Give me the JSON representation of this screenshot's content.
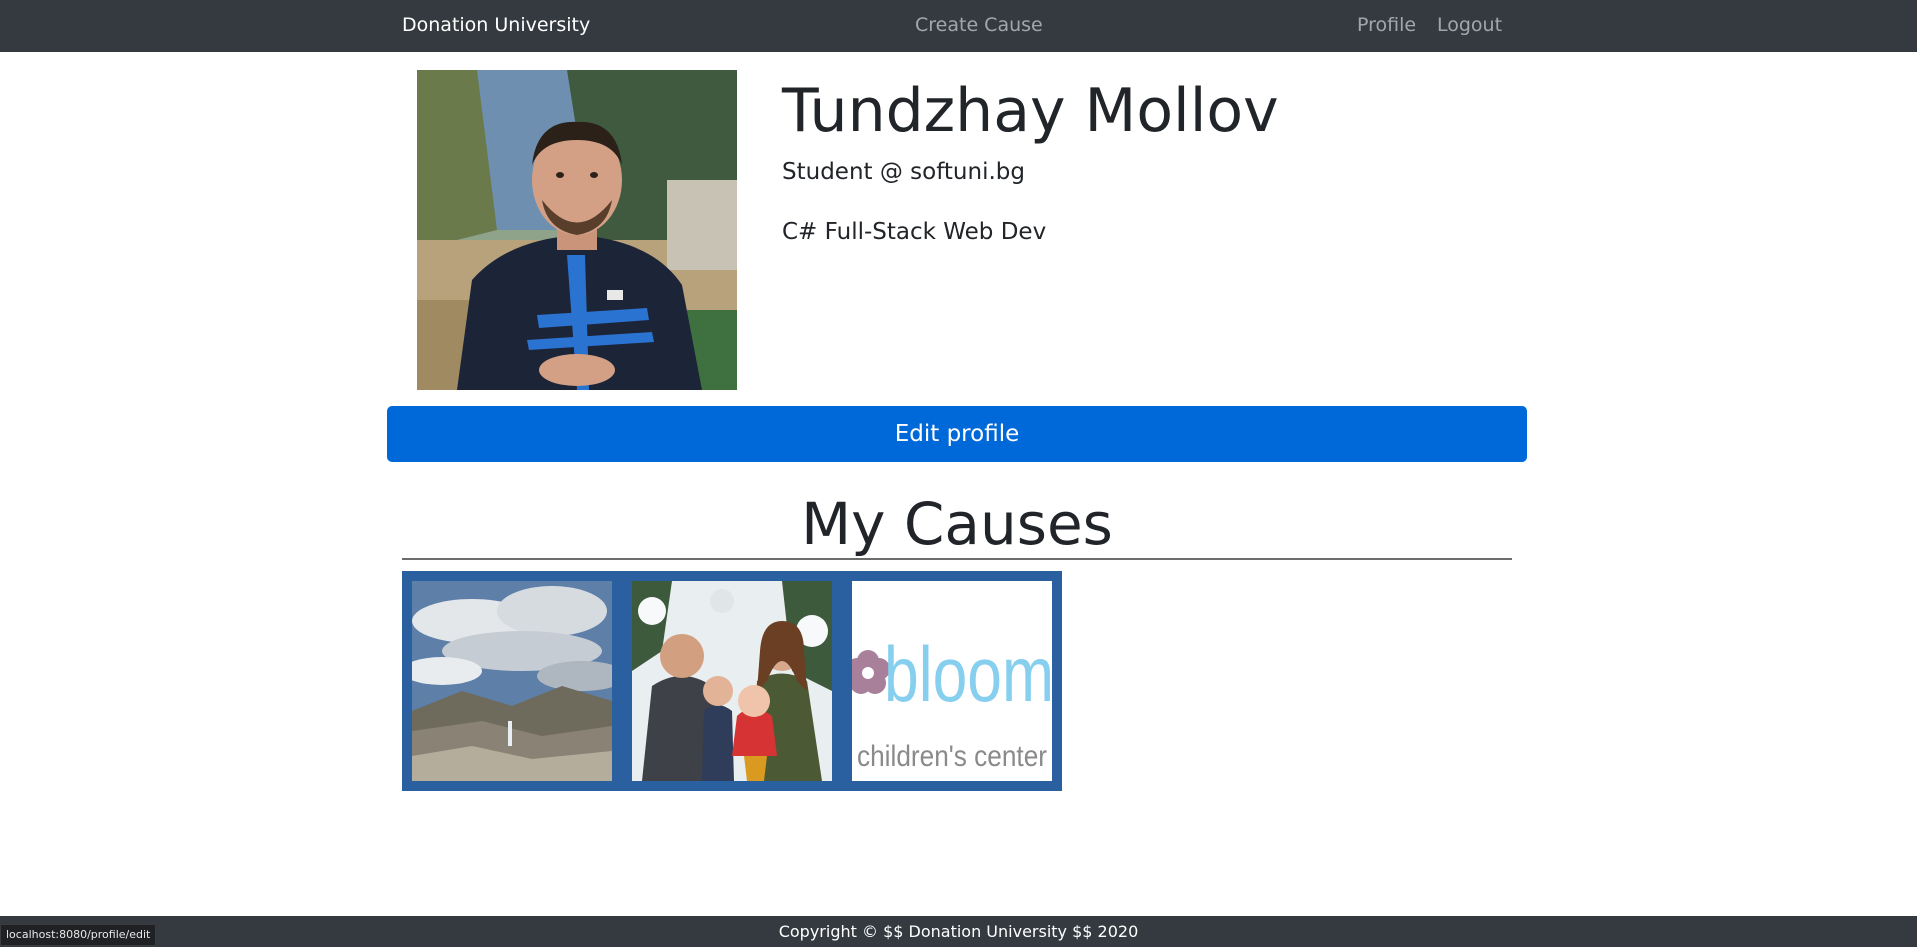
{
  "navbar": {
    "brand": "Donation University",
    "create_cause": "Create Cause",
    "profile": "Profile",
    "logout": "Logout"
  },
  "profile": {
    "name": "Tundzhay Mollov",
    "position": "Student @ softuni.bg",
    "description": "C# Full-Stack Web Dev",
    "edit_button": "Edit profile"
  },
  "causes": {
    "title": "My Causes",
    "items": [
      {
        "image": "mountain-landscape-photo"
      },
      {
        "image": "family-in-snow-photo"
      },
      {
        "image": "bloom-childrens-center-logo",
        "logo_text": "bloom",
        "logo_subtext": "children's center"
      }
    ]
  },
  "footer": {
    "copyright": "Copyright © $$ Donation University $$ 2020"
  },
  "status_bar": {
    "url": "localhost:8080/profile/edit"
  },
  "colors": {
    "navbar": "#343a40",
    "primary": "#0069d9",
    "causes_strip": "#2a5fa0"
  }
}
